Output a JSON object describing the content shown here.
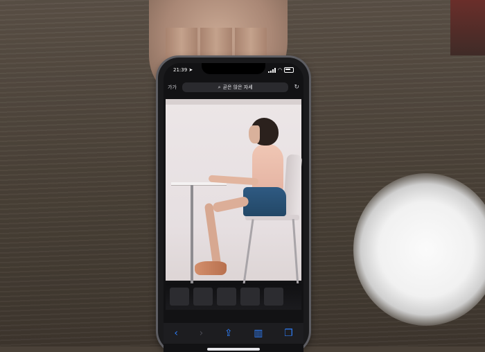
{
  "status_bar": {
    "time": "21:39",
    "location_icon": "location-arrow-icon",
    "signal_icon": "signal-bars-icon",
    "wifi_icon": "wifi-icon",
    "battery_icon": "battery-icon"
  },
  "browser": {
    "text_size_label": "가가",
    "search_icon": "search-icon",
    "url_text": "곧은 앉은 자세",
    "reload_icon": "reload-icon"
  },
  "toolbar": {
    "back_icon": "chevron-left-icon",
    "forward_icon": "chevron-right-icon",
    "share_icon": "share-icon",
    "bookmarks_icon": "book-icon",
    "tabs_icon": "tabs-icon"
  },
  "photo_subject": "woman-sitting-at-table-photo",
  "colors": {
    "ios_blue": "#2f7ef8",
    "screen_dark": "#121214",
    "photo_bg": "#ece6e7"
  }
}
